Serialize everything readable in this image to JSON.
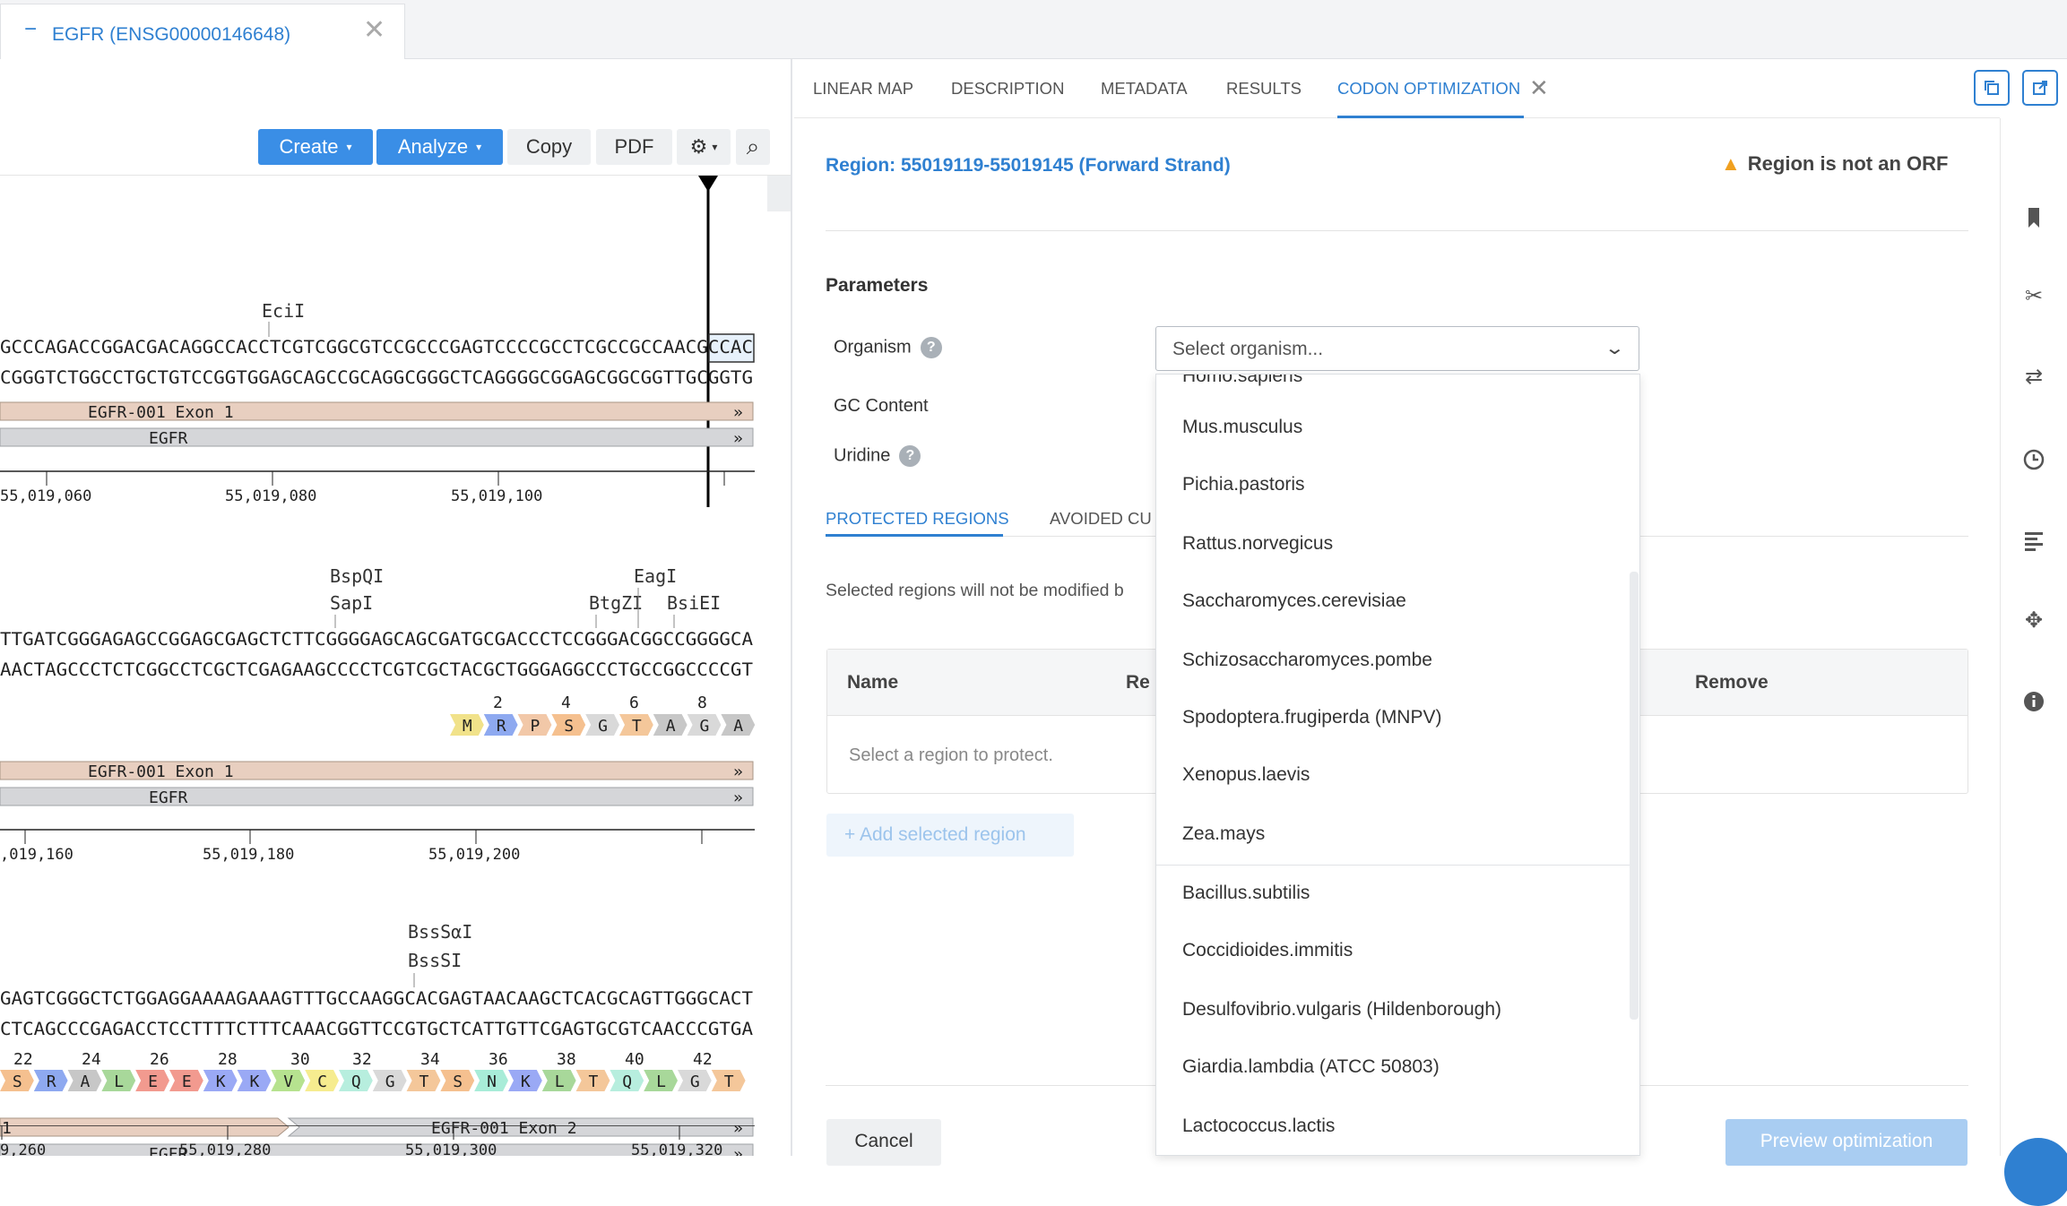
{
  "doc_tab": {
    "minus": "−",
    "title": "EGFR (ENSG00000146648)",
    "close": "✕"
  },
  "toolbar": {
    "create": "Create",
    "analyze": "Analyze",
    "copy": "Copy",
    "pdf": "PDF",
    "gear": "⚙",
    "caret": "▾",
    "search": "⌕"
  },
  "sequence": {
    "blocks": [
      {
        "enzymes": [
          "EciI"
        ],
        "top": "GCCCAGACCGGACGACAGGCCACCTCGTCGGCGTCCGCCCGAGTCCCCGCCTCGCCGCCAACGCCAC",
        "bottom": "CGGGTCTGGCCTGCTGTCCGGTGGAGCAGCCGCAGGCGGGCTCAGGGGCGGAGCGGCGGTTGCGGTG",
        "features": [
          "EGFR-001 Exon 1",
          "EGFR"
        ],
        "ticks": [
          "55,019,060",
          "55,019,080",
          "55,019,100"
        ]
      },
      {
        "enzymes": [
          "BspQI",
          "SapI",
          "EagI",
          "BtgZI",
          "BsiEI"
        ],
        "top": "TTGATCGGGAGAGCCGGAGCGAGCTCTTCGGGGAGCAGCGATGCGACCCTCCGGGACGGCCGGGGCA",
        "bottom": "AACTAGCCCTCTCGGCCTCGCTCGAGAAGCCCCTCGTCGCTACGCTGGGAGGCCCTGCCGGCCCCGT",
        "aa_numbers": [
          "2",
          "4",
          "6",
          "8"
        ],
        "aa": [
          "M",
          "R",
          "P",
          "S",
          "G",
          "T",
          "A",
          "G",
          "A"
        ],
        "features": [
          "EGFR-001 Exon 1",
          "EGFR"
        ],
        "ticks": [
          ",019,160",
          "55,019,180",
          "55,019,200"
        ]
      },
      {
        "enzymes": [
          "BssSαI",
          "BssSI"
        ],
        "top": "GAGTCGGGCTCTGGAGGAAAAGAAAGTTTGCCAAGGCACGAGTAACAAGCTCACGCAGTTGGGCACT",
        "bottom": "CTCAGCCCGAGACCTCCTTTTCTTTCAAACGGTTCCGTGCTCATTGTTCGAGTGCGTCAACCCGTGA",
        "aa_numbers": [
          "22",
          "24",
          "26",
          "28",
          "30",
          "32",
          "34",
          "36",
          "38",
          "40",
          "42"
        ],
        "aa": [
          "S",
          "R",
          "A",
          "L",
          "E",
          "E",
          "K",
          "K",
          "V",
          "C",
          "Q",
          "G",
          "T",
          "S",
          "N",
          "K",
          "L",
          "T",
          "Q",
          "L",
          "G",
          "T"
        ],
        "features": [
          "1",
          "EGFR-001 Exon 2",
          "EGFR"
        ],
        "ticks": [
          "9,260",
          "55,019,280",
          "55,019,300",
          "55,019,320"
        ]
      }
    ],
    "chevrons": "»"
  },
  "right": {
    "tabs": [
      "LINEAR MAP",
      "DESCRIPTION",
      "METADATA",
      "RESULTS",
      "CODON OPTIMIZATION"
    ],
    "tab_close": "✕",
    "region_title": "Region: 55019119-55019145 (Forward Strand)",
    "orf_warning": "Region is not an ORF",
    "parameters_heading": "Parameters",
    "organism_label": "Organism",
    "gc_label": "GC Content",
    "uridine_label": "Uridine",
    "help_mark": "?",
    "organism_placeholder": "Select organism...",
    "subtabs": [
      "PROTECTED REGIONS",
      "AVOIDED CU"
    ],
    "selected_note": "Selected regions will not be modified b",
    "table_headers": [
      "Name",
      "Re",
      "Remove"
    ],
    "empty_row": "Select a region to protect.",
    "add_region": "+ Add selected region",
    "cancel": "Cancel",
    "preview": "Preview optimization"
  },
  "organism_options": [
    "Homo.sapiens",
    "Mus.musculus",
    "Pichia.pastoris",
    "Rattus.norvegicus",
    "Saccharomyces.cerevisiae",
    "Schizosaccharomyces.pombe",
    "Spodoptera.frugiperda (MNPV)",
    "Xenopus.laevis",
    "Zea.mays",
    "Bacillus.subtilis",
    "Coccidioides.immitis",
    "Desulfovibrio.vulgaris (Hildenborough)",
    "Giardia.lambdia (ATCC 50803)",
    "Lactococcus.lactis"
  ],
  "colors": {
    "accent": "#2f80d1",
    "exon": "#e8cfc0",
    "gene": "#d5d6d9",
    "warning": "#f0a020"
  }
}
